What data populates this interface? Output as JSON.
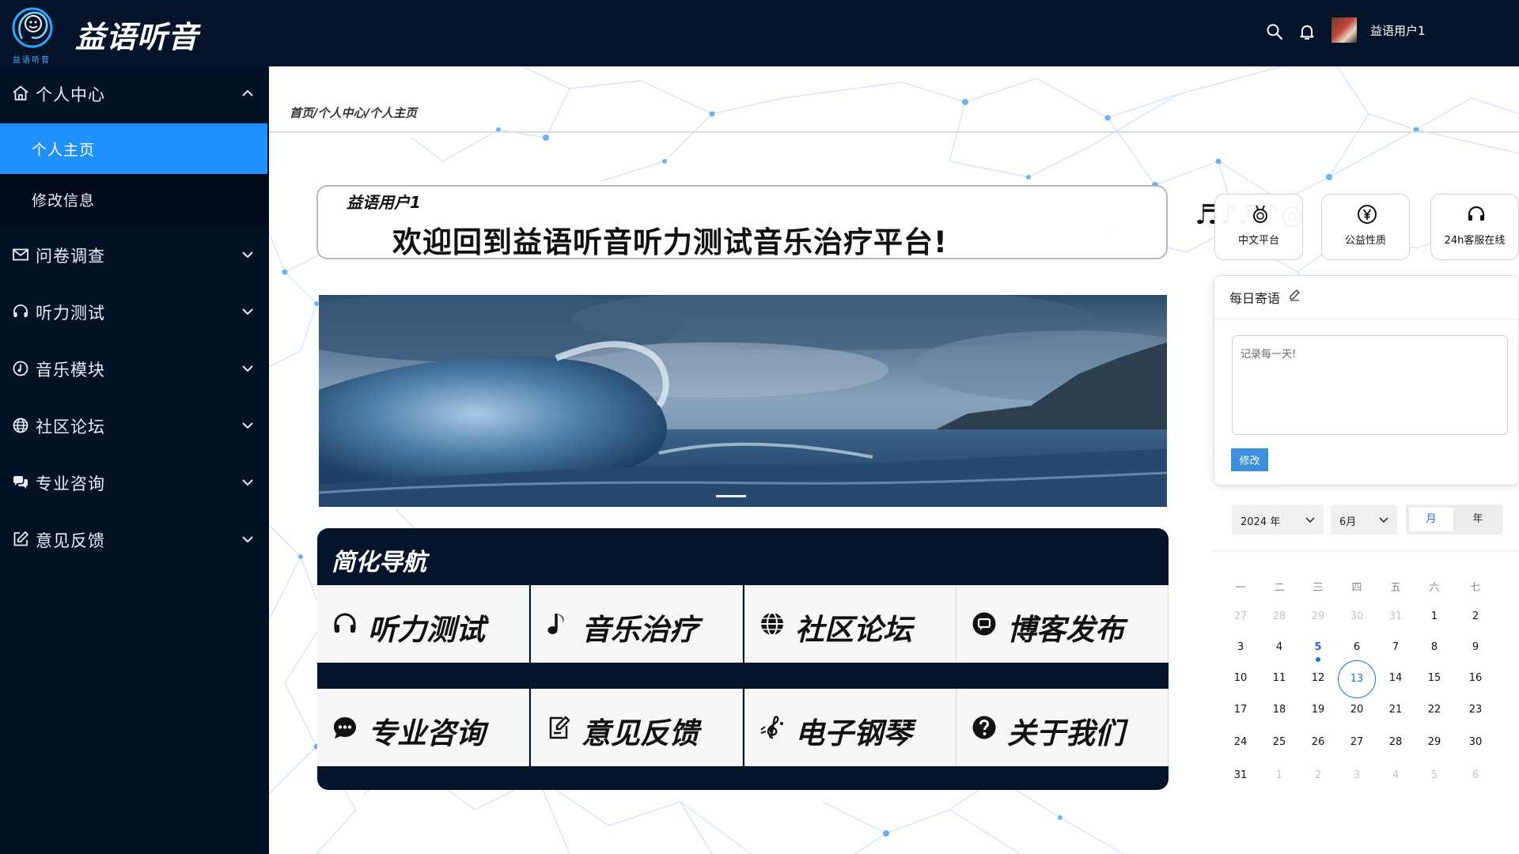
{
  "app": {
    "brand": "益语听音",
    "brand_sub": "益语听音"
  },
  "header": {
    "icons": [
      "search-icon",
      "bell-icon"
    ],
    "user_name": "益语用户1"
  },
  "sidebar": {
    "groups": [
      {
        "label": "个人中心",
        "icon": "home-icon",
        "expanded": true,
        "items": [
          {
            "label": "个人主页",
            "active": true
          },
          {
            "label": "修改信息",
            "active": false
          }
        ]
      },
      {
        "label": "问卷调查",
        "icon": "mail-icon",
        "expanded": false
      },
      {
        "label": "听力测试",
        "icon": "headphones-icon",
        "expanded": false
      },
      {
        "label": "音乐模块",
        "icon": "music-disc-icon",
        "expanded": false
      },
      {
        "label": "社区论坛",
        "icon": "globe-icon",
        "expanded": false
      },
      {
        "label": "专业咨询",
        "icon": "chat-bubbles-icon",
        "expanded": false
      },
      {
        "label": "意见反馈",
        "icon": "edit-icon",
        "expanded": false
      }
    ]
  },
  "main": {
    "breadcrumb": "首页/个人中心/个人主页",
    "welcome": {
      "user": "益语用户1",
      "message": "欢迎回到益语听音听力测试音乐治疗平台!",
      "notes": "♬♪♬♪◎"
    },
    "banner": {
      "subject": "ocean-wave-image"
    },
    "nav": {
      "title": "简化导航",
      "items": [
        {
          "label": "听力测试",
          "icon": "headphones-icon"
        },
        {
          "label": "音乐治疗",
          "icon": "music-note-icon"
        },
        {
          "label": "社区论坛",
          "icon": "globe-icon"
        },
        {
          "label": "博客发布",
          "icon": "message-square-icon"
        },
        {
          "label": "专业咨询",
          "icon": "chat-dots-icon"
        },
        {
          "label": "意见反馈",
          "icon": "document-edit-icon"
        },
        {
          "label": "电子钢琴",
          "icon": "treble-clef-icon"
        },
        {
          "label": "关于我们",
          "icon": "question-circle-icon"
        }
      ]
    }
  },
  "right": {
    "features": [
      {
        "label": "中文平台",
        "icon": "medal-icon"
      },
      {
        "label": "公益性质",
        "icon": "yen-circle-icon"
      },
      {
        "label": "24h客服在线",
        "icon": "headset-icon"
      }
    ],
    "quote": {
      "title": "每日寄语",
      "placeholder": "记录每一天!",
      "button": "修改"
    },
    "calendar": {
      "year": "2024 年",
      "month": "6月",
      "toggle": [
        "月",
        "年"
      ],
      "active_toggle": "月",
      "weekdays": [
        "一",
        "二",
        "三",
        "四",
        "五",
        "六",
        "七"
      ],
      "weeks": [
        [
          "27",
          "28",
          "29",
          "30",
          "31",
          "1",
          "2"
        ],
        [
          "3",
          "4",
          "5",
          "6",
          "7",
          "8",
          "9"
        ],
        [
          "10",
          "11",
          "12",
          "13",
          "14",
          "15",
          "16"
        ],
        [
          "17",
          "18",
          "19",
          "20",
          "21",
          "22",
          "23"
        ],
        [
          "24",
          "25",
          "26",
          "27",
          "28",
          "29",
          "30"
        ],
        [
          "31",
          "1",
          "2",
          "3",
          "4",
          "5",
          "6"
        ]
      ],
      "today": "13",
      "event_day": "5"
    }
  },
  "colors": {
    "header_bg": "#04142b",
    "sidebar_bg": "#031225",
    "active_item": "#1e90ff",
    "accent_blue": "#1e6fd9",
    "button_blue": "#3d8fdc"
  }
}
